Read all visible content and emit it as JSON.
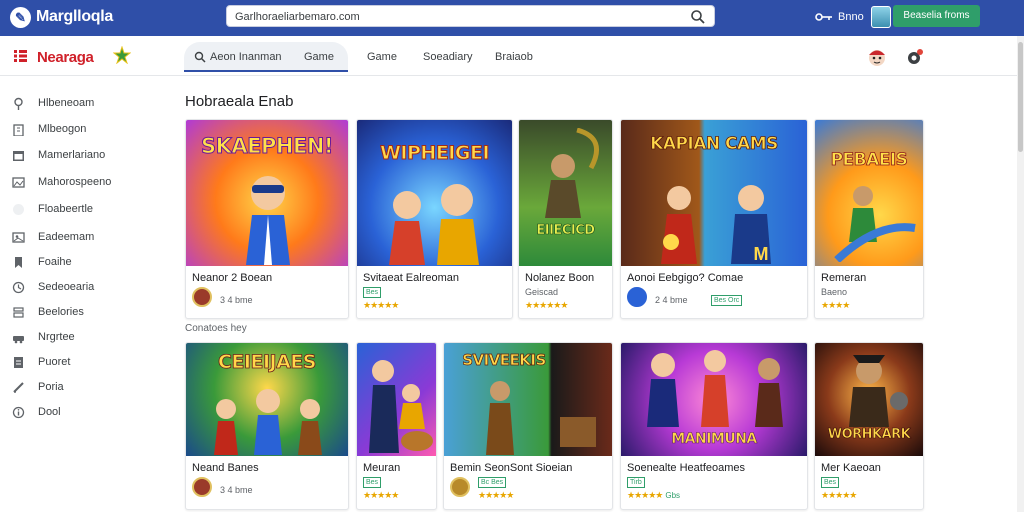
{
  "app": {
    "title": "Marglloqla"
  },
  "search": {
    "value": "Garlhoraeliarbemaro.com"
  },
  "user": {
    "label": "Bnno"
  },
  "cta": {
    "label": "Beaselia froms"
  },
  "brand": {
    "name": "Nearaga"
  },
  "tabs": [
    {
      "label": "Aeon Inanman",
      "extra": "Game"
    },
    {
      "label": "Game"
    },
    {
      "label": "Soeadiary"
    },
    {
      "label": "Braiaob"
    }
  ],
  "sidebar": {
    "items": [
      {
        "label": "Hlbeneoam",
        "icon": "pin-icon"
      },
      {
        "label": "Mlbeogon",
        "icon": "building-icon"
      },
      {
        "label": "Mamerlariano",
        "icon": "calendar-icon"
      },
      {
        "label": "Mahorospeeno",
        "icon": "photo-icon"
      },
      {
        "label": "Floabeertle",
        "icon": "blank-icon"
      },
      {
        "label": "Eadeemam",
        "icon": "photo-icon"
      },
      {
        "label": "Foaihe",
        "icon": "bookmark-icon"
      },
      {
        "label": "Sedeoearia",
        "icon": "clock-icon"
      },
      {
        "label": "Beelories",
        "icon": "stack-icon"
      },
      {
        "label": "Nrgrtee",
        "icon": "car-icon"
      },
      {
        "label": "Puoret",
        "icon": "doc-icon"
      },
      {
        "label": "Poria",
        "icon": "pen-icon"
      },
      {
        "label": "Dool",
        "icon": "info-icon"
      }
    ]
  },
  "main": {
    "section_title": "Hobraeala Enab",
    "row2_label": "Conatoes hey",
    "row1": [
      {
        "art": "SKAEPHEN!",
        "title": "Neanor 2 Boean",
        "meta": "3 4 bme",
        "stars": "★★★★",
        "accent": "#ff7a1a"
      },
      {
        "art": "WIPHEIGEI",
        "title": "Svitaeat Ealreoman",
        "meta": "Bes",
        "stars": "★★★★★",
        "accent": "#2a62d6"
      },
      {
        "art": "EIIECICD",
        "title": "Nolanez Boon",
        "meta": "Geiscad",
        "stars": "★★★★★★",
        "accent": "#2d8a3a"
      },
      {
        "art": "KAPIAN CAMS",
        "title": "Aonoi Eebgigo? Comae",
        "meta": "2 4 bme",
        "tag": "Bes Orc",
        "stars": "",
        "accent": "#e8c21a"
      },
      {
        "art": "PEBAEIS",
        "title": "Remeran",
        "meta": "Baeno",
        "stars": "★★★★",
        "accent": "#ff9a1a"
      }
    ],
    "row2": [
      {
        "art": "CEIEIJAES",
        "title": "Neand Banes",
        "meta": "3 4 bme",
        "stars": "",
        "accent": "#3a78d8"
      },
      {
        "art": "",
        "title": "Meuran",
        "meta": "",
        "tag": "Bes",
        "stars": "★★★★★",
        "accent": "#d63ab0"
      },
      {
        "art": "SVIVEEKIS",
        "title": "Bemin SeonSont Sioeian",
        "meta": "",
        "tag": "Bc Bes",
        "stars": "★★★★★",
        "accent": "#3a9a3a"
      },
      {
        "art": "MANIMUNA",
        "title": "Soenealte Heatfeoames",
        "meta": "",
        "tag": "Tirb",
        "stars": "★★★★★",
        "star_num": "Gbs",
        "accent": "#b83ad6"
      },
      {
        "art": "WORHKARK",
        "title": "Mer Kaeoan",
        "meta": "",
        "tag": "Bes",
        "stars": "★★★★★",
        "accent": "#ff8a1a"
      }
    ]
  }
}
